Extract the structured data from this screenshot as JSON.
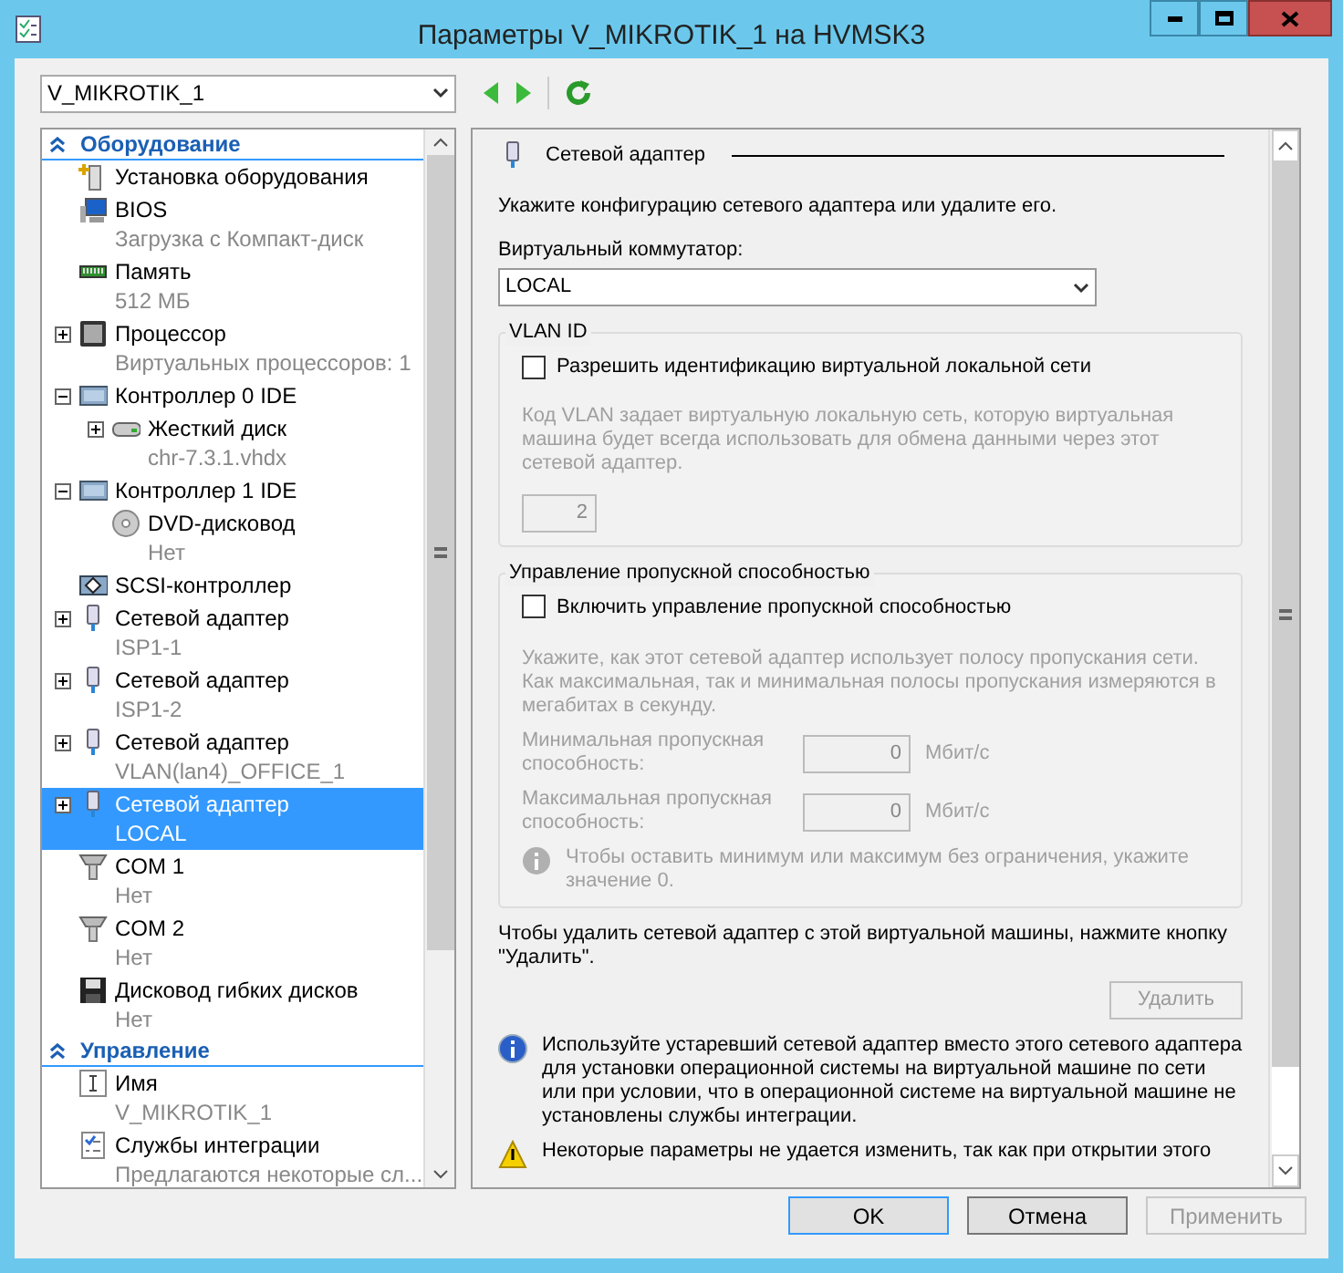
{
  "window": {
    "title": "Параметры V_MIKROTIK_1 на HVMSK3"
  },
  "vm_select": {
    "value": "V_MIKROTIK_1"
  },
  "sidebar": {
    "sections": [
      {
        "title": "Оборудование",
        "expanded": true,
        "items": [
          {
            "kind": "hardware-add",
            "label": "Установка оборудования",
            "selected": false
          },
          {
            "kind": "bios",
            "label": "BIOS",
            "sublabel": "Загрузка с Компакт-диск",
            "selected": false
          },
          {
            "kind": "memory",
            "label": "Память",
            "sublabel": "512 МБ",
            "selected": false
          },
          {
            "kind": "cpu",
            "label": "Процессор",
            "sublabel": "Виртуальных процессоров: 1",
            "expanded": false,
            "selected": false
          },
          {
            "kind": "controller",
            "label": "Контроллер 0 IDE",
            "expanded": true,
            "selected": false,
            "children": [
              {
                "kind": "disk",
                "label": "Жесткий диск",
                "sublabel": "chr-7.3.1.vhdx",
                "expanded": false,
                "selected": false
              }
            ]
          },
          {
            "kind": "controller",
            "label": "Контроллер 1 IDE",
            "expanded": true,
            "selected": false,
            "children": [
              {
                "kind": "dvd",
                "label": "DVD-дисковод",
                "sublabel": "Нет",
                "selected": false
              }
            ]
          },
          {
            "kind": "scsi",
            "label": "SCSI-контроллер",
            "selected": false
          },
          {
            "kind": "network",
            "label": "Сетевой адаптер",
            "sublabel": "ISP1-1",
            "expanded": false,
            "selected": false
          },
          {
            "kind": "network",
            "label": "Сетевой адаптер",
            "sublabel": "ISP1-2",
            "expanded": false,
            "selected": false
          },
          {
            "kind": "network",
            "label": "Сетевой адаптер",
            "sublabel": "VLAN(lan4)_OFFICE_1",
            "expanded": false,
            "selected": false
          },
          {
            "kind": "network",
            "label": "Сетевой адаптер",
            "sublabel": "LOCAL",
            "expanded": false,
            "selected": true
          },
          {
            "kind": "com",
            "label": "COM 1",
            "sublabel": "Нет",
            "selected": false
          },
          {
            "kind": "com",
            "label": "COM 2",
            "sublabel": "Нет",
            "selected": false
          },
          {
            "kind": "floppy",
            "label": "Дисковод гибких дисков",
            "sublabel": "Нет",
            "selected": false
          }
        ]
      },
      {
        "title": "Управление",
        "expanded": true,
        "items": [
          {
            "kind": "name",
            "label": "Имя",
            "sublabel": "V_MIKROTIK_1",
            "selected": false
          },
          {
            "kind": "integration",
            "label": "Службы интеграции",
            "sublabel": "Предлагаются некоторые сл...",
            "selected": false
          }
        ]
      }
    ]
  },
  "panel": {
    "title": "Сетевой адаптер",
    "intro": "Укажите конфигурацию сетевого адаптера или удалите его.",
    "switch_label": "Виртуальный коммутатор:",
    "switch_value": "LOCAL",
    "vlan": {
      "title": "VLAN ID",
      "checkbox": {
        "label": "Разрешить идентификацию виртуальной локальной сети",
        "checked": false
      },
      "description": "Код VLAN задает виртуальную локальную сеть, которую виртуальная машина будет всегда использовать для обмена данными через этот сетевой адаптер.",
      "value": "2",
      "disabled": true
    },
    "bandwidth": {
      "title": "Управление пропускной способностью",
      "checkbox": {
        "label": "Включить управление пропускной способностью",
        "checked": false
      },
      "description": "Укажите, как этот сетевой адаптер использует полосу пропускания сети. Как максимальная, так и минимальная полосы пропускания измеряются в мегабитах в секунду.",
      "disabled": true,
      "fields": [
        {
          "label": "Минимальная пропускная способность:",
          "value": "0",
          "unit": "Мбит/с"
        },
        {
          "label": "Максимальная пропускная способность:",
          "value": "0",
          "unit": "Мбит/с"
        }
      ],
      "note": "Чтобы оставить минимум или максимум без ограничения, укажите значение 0."
    },
    "remove_text": "Чтобы удалить сетевой адаптер с этой виртуальной машины, нажмите кнопку \"Удалить\".",
    "remove_button": {
      "label": "Удалить",
      "disabled": true
    },
    "notes": [
      {
        "kind": "info",
        "text": "Используйте устаревший сетевой адаптер вместо этого сетевого адаптера для установки операционной системы на виртуальной машине по сети или при условии, что в операционной системе на виртуальной машине не установлены службы интеграции."
      },
      {
        "kind": "warning",
        "text": "Некоторые параметры не удается изменить, так как при открытии этого"
      }
    ]
  },
  "buttons": [
    {
      "label": "OK",
      "default": true,
      "disabled": false
    },
    {
      "label": "Отмена",
      "default": false,
      "disabled": false
    },
    {
      "label": "Применить",
      "default": false,
      "disabled": true
    }
  ]
}
